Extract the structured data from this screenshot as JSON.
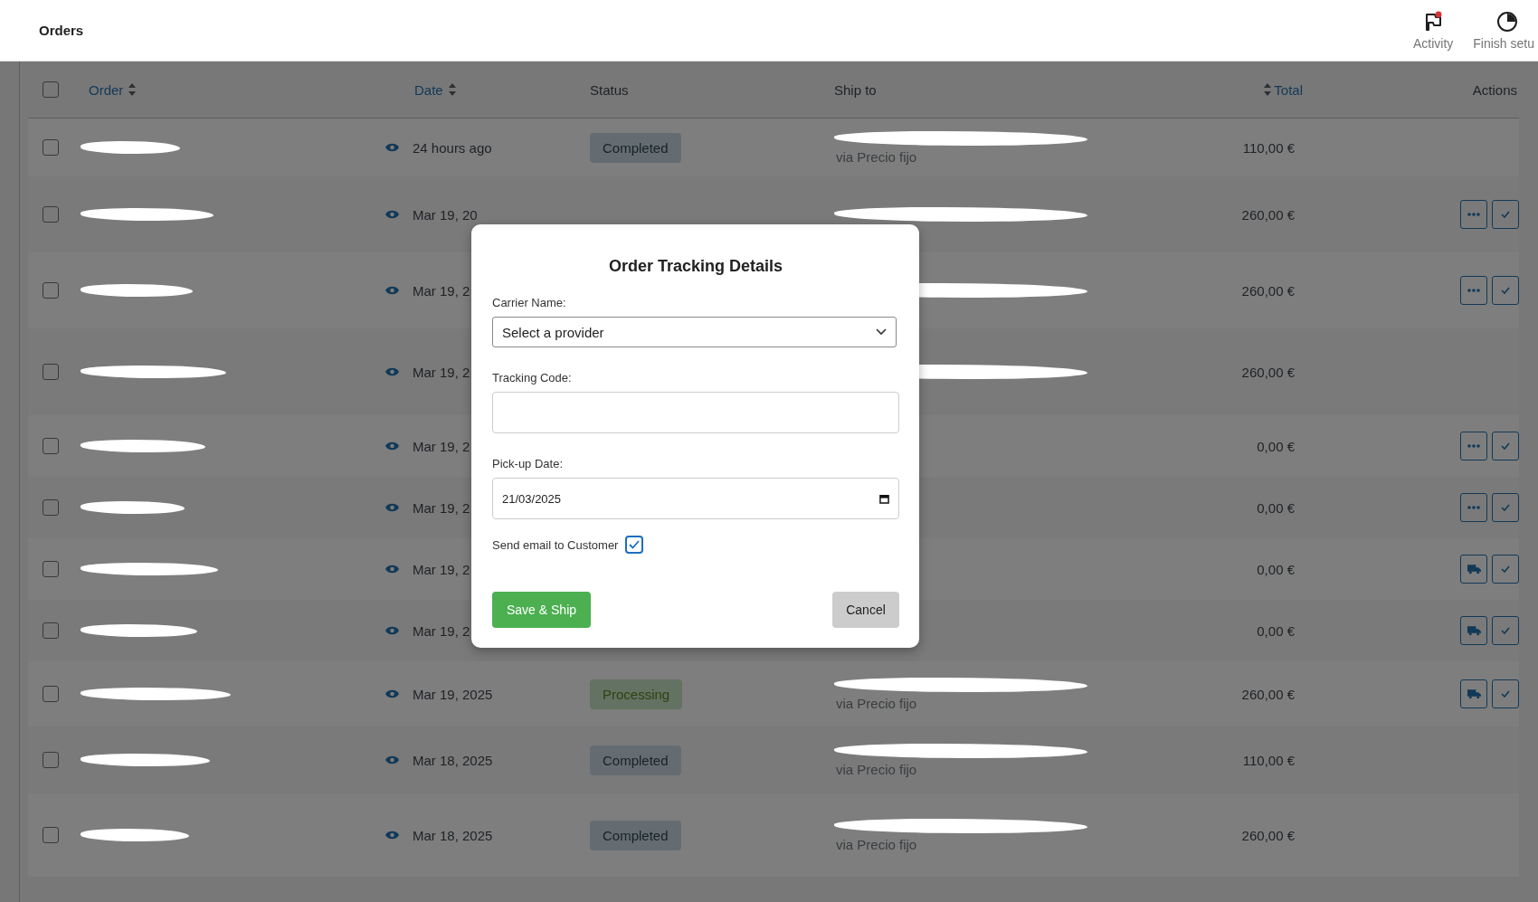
{
  "header": {
    "title": "Orders",
    "actions": [
      {
        "kind": "activity",
        "label": "Activity",
        "notification": true
      },
      {
        "kind": "setup",
        "label": "Finish setu"
      }
    ]
  },
  "table": {
    "select_all_checked": false,
    "columns": [
      {
        "kind": "order",
        "label": "Order",
        "sortable": true
      },
      {
        "kind": "date",
        "label": "Date",
        "sortable": true
      },
      {
        "kind": "status",
        "label": "Status",
        "sortable": false
      },
      {
        "kind": "ship",
        "label": "Ship to",
        "sortable": false
      },
      {
        "kind": "total",
        "label": "Total",
        "sortable": true
      },
      {
        "kind": "actions",
        "label": "Actions",
        "sortable": false
      }
    ],
    "rows": [
      {
        "checked": false,
        "date": "24 hours ago",
        "status": "Completed",
        "ship_redacted": true,
        "ship_method": "via Precio fijo",
        "total": "110,00 €",
        "actions": []
      },
      {
        "checked": false,
        "date": "Mar 19, 20",
        "ship_redacted": true,
        "total": "260,00 €",
        "actions": [
          {
            "kind": "more"
          },
          {
            "kind": "complete"
          }
        ]
      },
      {
        "checked": false,
        "date": "Mar 19, 2",
        "ship_redacted": true,
        "total": "260,00 €",
        "actions": [
          {
            "kind": "more"
          },
          {
            "kind": "complete"
          }
        ]
      },
      {
        "checked": false,
        "date": "Mar 19, 2",
        "ship_redacted": true,
        "total": "260,00 €",
        "actions": []
      },
      {
        "checked": false,
        "date": "Mar 19, 2",
        "ship_redacted": false,
        "total": "0,00 €",
        "actions": [
          {
            "kind": "more"
          },
          {
            "kind": "complete"
          }
        ]
      },
      {
        "checked": false,
        "date": "Mar 19, 2",
        "ship_redacted": false,
        "total": "0,00 €",
        "actions": [
          {
            "kind": "more"
          },
          {
            "kind": "complete"
          }
        ]
      },
      {
        "checked": false,
        "date": "Mar 19, 2",
        "ship_redacted": false,
        "total": "0,00 €",
        "actions": [
          {
            "kind": "ship"
          },
          {
            "kind": "complete"
          }
        ]
      },
      {
        "checked": false,
        "date": "Mar 19, 2",
        "ship_redacted": false,
        "total": "0,00 €",
        "actions": [
          {
            "kind": "ship"
          },
          {
            "kind": "complete"
          }
        ]
      },
      {
        "checked": false,
        "date": "Mar 19, 2025",
        "status": "Processing",
        "ship_redacted": true,
        "ship_method": "via Precio fijo",
        "total": "260,00 €",
        "actions": [
          {
            "kind": "ship"
          },
          {
            "kind": "complete"
          }
        ]
      },
      {
        "checked": false,
        "date": "Mar 18, 2025",
        "status": "Completed",
        "ship_redacted": true,
        "ship_method": "via Precio fijo",
        "total": "110,00 €",
        "actions": []
      },
      {
        "checked": false,
        "date": "Mar 18, 2025",
        "status": "Completed",
        "ship_redacted": true,
        "ship_method": "via Precio fijo",
        "total": "260,00 €",
        "actions": []
      }
    ]
  },
  "modal": {
    "title": "Order Tracking Details",
    "carrier_label": "Carrier Name:",
    "carrier_value": "Select a provider",
    "tracking_label": "Tracking Code:",
    "date_label": "Pick-up Date:",
    "date_value": "21/03/2025",
    "email_label": "Send email to Customer",
    "email_checked": true,
    "save_button": "Save & Ship",
    "cancel_button": "Cancel"
  }
}
